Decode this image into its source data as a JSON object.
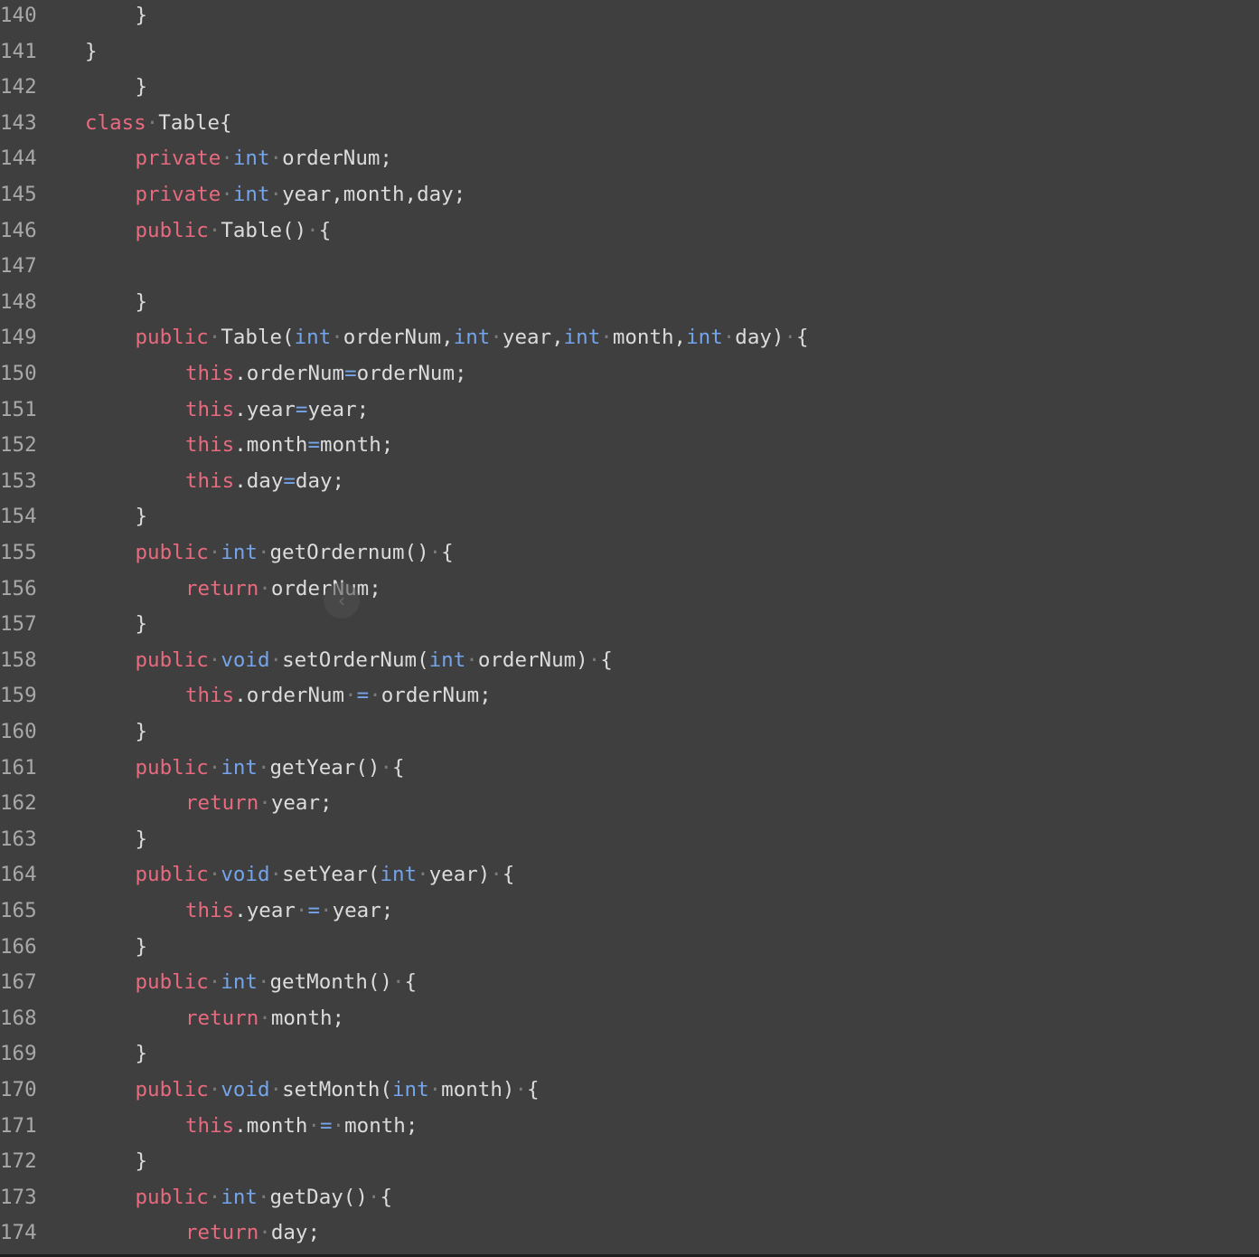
{
  "editor": {
    "lines": [
      {
        "num": "140",
        "indent": 1,
        "tokens": [
          {
            "t": "}",
            "c": "plain"
          }
        ]
      },
      {
        "num": "141",
        "indent": 0,
        "tokens": [
          {
            "t": "}",
            "c": "plain"
          }
        ]
      },
      {
        "num": "142",
        "indent": 1,
        "tokens": [
          {
            "t": "}",
            "c": "plain"
          }
        ]
      },
      {
        "num": "143",
        "indent": 0,
        "tokens": [
          {
            "t": "class",
            "c": "kw"
          },
          {
            "t": "·",
            "c": "ws"
          },
          {
            "t": "Table{",
            "c": "plain"
          }
        ]
      },
      {
        "num": "144",
        "indent": 1,
        "tokens": [
          {
            "t": "private",
            "c": "kw"
          },
          {
            "t": "·",
            "c": "ws"
          },
          {
            "t": "int",
            "c": "ty"
          },
          {
            "t": "·",
            "c": "ws"
          },
          {
            "t": "orderNum;",
            "c": "plain"
          }
        ]
      },
      {
        "num": "145",
        "indent": 1,
        "tokens": [
          {
            "t": "private",
            "c": "kw"
          },
          {
            "t": "·",
            "c": "ws"
          },
          {
            "t": "int",
            "c": "ty"
          },
          {
            "t": "·",
            "c": "ws"
          },
          {
            "t": "year,month,day;",
            "c": "plain"
          }
        ]
      },
      {
        "num": "146",
        "indent": 1,
        "tokens": [
          {
            "t": "public",
            "c": "kw"
          },
          {
            "t": "·",
            "c": "ws"
          },
          {
            "t": "Table()",
            "c": "plain"
          },
          {
            "t": "·",
            "c": "ws"
          },
          {
            "t": "{",
            "c": "plain"
          }
        ]
      },
      {
        "num": "147",
        "indent": 0,
        "tokens": []
      },
      {
        "num": "148",
        "indent": 1,
        "tokens": [
          {
            "t": "}",
            "c": "plain"
          }
        ]
      },
      {
        "num": "149",
        "indent": 1,
        "tokens": [
          {
            "t": "public",
            "c": "kw"
          },
          {
            "t": "·",
            "c": "ws"
          },
          {
            "t": "Table(",
            "c": "plain"
          },
          {
            "t": "int",
            "c": "ty"
          },
          {
            "t": "·",
            "c": "ws"
          },
          {
            "t": "orderNum,",
            "c": "plain"
          },
          {
            "t": "int",
            "c": "ty"
          },
          {
            "t": "·",
            "c": "ws"
          },
          {
            "t": "year,",
            "c": "plain"
          },
          {
            "t": "int",
            "c": "ty"
          },
          {
            "t": "·",
            "c": "ws"
          },
          {
            "t": "month,",
            "c": "plain"
          },
          {
            "t": "int",
            "c": "ty"
          },
          {
            "t": "·",
            "c": "ws"
          },
          {
            "t": "day)",
            "c": "plain"
          },
          {
            "t": "·",
            "c": "ws"
          },
          {
            "t": "{",
            "c": "plain"
          }
        ]
      },
      {
        "num": "150",
        "indent": 2,
        "tokens": [
          {
            "t": "this",
            "c": "kw"
          },
          {
            "t": ".orderNum",
            "c": "plain"
          },
          {
            "t": "=",
            "c": "op"
          },
          {
            "t": "orderNum;",
            "c": "plain"
          }
        ]
      },
      {
        "num": "151",
        "indent": 2,
        "tokens": [
          {
            "t": "this",
            "c": "kw"
          },
          {
            "t": ".year",
            "c": "plain"
          },
          {
            "t": "=",
            "c": "op"
          },
          {
            "t": "year;",
            "c": "plain"
          }
        ]
      },
      {
        "num": "152",
        "indent": 2,
        "tokens": [
          {
            "t": "this",
            "c": "kw"
          },
          {
            "t": ".month",
            "c": "plain"
          },
          {
            "t": "=",
            "c": "op"
          },
          {
            "t": "month;",
            "c": "plain"
          }
        ]
      },
      {
        "num": "153",
        "indent": 2,
        "tokens": [
          {
            "t": "this",
            "c": "kw"
          },
          {
            "t": ".day",
            "c": "plain"
          },
          {
            "t": "=",
            "c": "op"
          },
          {
            "t": "day;",
            "c": "plain"
          }
        ]
      },
      {
        "num": "154",
        "indent": 1,
        "tokens": [
          {
            "t": "}",
            "c": "plain"
          }
        ]
      },
      {
        "num": "155",
        "indent": 1,
        "tokens": [
          {
            "t": "public",
            "c": "kw"
          },
          {
            "t": "·",
            "c": "ws"
          },
          {
            "t": "int",
            "c": "ty"
          },
          {
            "t": "·",
            "c": "ws"
          },
          {
            "t": "getOrdernum()",
            "c": "plain"
          },
          {
            "t": "·",
            "c": "ws"
          },
          {
            "t": "{",
            "c": "plain"
          }
        ]
      },
      {
        "num": "156",
        "indent": 2,
        "tokens": [
          {
            "t": "return",
            "c": "kw"
          },
          {
            "t": "·",
            "c": "ws"
          },
          {
            "t": "orderNum;",
            "c": "plain"
          }
        ]
      },
      {
        "num": "157",
        "indent": 1,
        "tokens": [
          {
            "t": "}",
            "c": "plain"
          }
        ]
      },
      {
        "num": "158",
        "indent": 1,
        "tokens": [
          {
            "t": "public",
            "c": "kw"
          },
          {
            "t": "·",
            "c": "ws"
          },
          {
            "t": "void",
            "c": "ty"
          },
          {
            "t": "·",
            "c": "ws"
          },
          {
            "t": "setOrderNum(",
            "c": "plain"
          },
          {
            "t": "int",
            "c": "ty"
          },
          {
            "t": "·",
            "c": "ws"
          },
          {
            "t": "orderNum)",
            "c": "plain"
          },
          {
            "t": "·",
            "c": "ws"
          },
          {
            "t": "{",
            "c": "plain"
          }
        ]
      },
      {
        "num": "159",
        "indent": 2,
        "tokens": [
          {
            "t": "this",
            "c": "kw"
          },
          {
            "t": ".orderNum",
            "c": "plain"
          },
          {
            "t": "·",
            "c": "ws"
          },
          {
            "t": "=",
            "c": "op"
          },
          {
            "t": "·",
            "c": "ws"
          },
          {
            "t": "orderNum;",
            "c": "plain"
          }
        ]
      },
      {
        "num": "160",
        "indent": 1,
        "tokens": [
          {
            "t": "}",
            "c": "plain"
          }
        ]
      },
      {
        "num": "161",
        "indent": 1,
        "tokens": [
          {
            "t": "public",
            "c": "kw"
          },
          {
            "t": "·",
            "c": "ws"
          },
          {
            "t": "int",
            "c": "ty"
          },
          {
            "t": "·",
            "c": "ws"
          },
          {
            "t": "getYear()",
            "c": "plain"
          },
          {
            "t": "·",
            "c": "ws"
          },
          {
            "t": "{",
            "c": "plain"
          }
        ]
      },
      {
        "num": "162",
        "indent": 2,
        "tokens": [
          {
            "t": "return",
            "c": "kw"
          },
          {
            "t": "·",
            "c": "ws"
          },
          {
            "t": "year;",
            "c": "plain"
          }
        ]
      },
      {
        "num": "163",
        "indent": 1,
        "tokens": [
          {
            "t": "}",
            "c": "plain"
          }
        ]
      },
      {
        "num": "164",
        "indent": 1,
        "tokens": [
          {
            "t": "public",
            "c": "kw"
          },
          {
            "t": "·",
            "c": "ws"
          },
          {
            "t": "void",
            "c": "ty"
          },
          {
            "t": "·",
            "c": "ws"
          },
          {
            "t": "setYear(",
            "c": "plain"
          },
          {
            "t": "int",
            "c": "ty"
          },
          {
            "t": "·",
            "c": "ws"
          },
          {
            "t": "year)",
            "c": "plain"
          },
          {
            "t": "·",
            "c": "ws"
          },
          {
            "t": "{",
            "c": "plain"
          }
        ]
      },
      {
        "num": "165",
        "indent": 2,
        "tokens": [
          {
            "t": "this",
            "c": "kw"
          },
          {
            "t": ".year",
            "c": "plain"
          },
          {
            "t": "·",
            "c": "ws"
          },
          {
            "t": "=",
            "c": "op"
          },
          {
            "t": "·",
            "c": "ws"
          },
          {
            "t": "year;",
            "c": "plain"
          }
        ]
      },
      {
        "num": "166",
        "indent": 1,
        "tokens": [
          {
            "t": "}",
            "c": "plain"
          }
        ]
      },
      {
        "num": "167",
        "indent": 1,
        "tokens": [
          {
            "t": "public",
            "c": "kw"
          },
          {
            "t": "·",
            "c": "ws"
          },
          {
            "t": "int",
            "c": "ty"
          },
          {
            "t": "·",
            "c": "ws"
          },
          {
            "t": "getMonth()",
            "c": "plain"
          },
          {
            "t": "·",
            "c": "ws"
          },
          {
            "t": "{",
            "c": "plain"
          }
        ]
      },
      {
        "num": "168",
        "indent": 2,
        "tokens": [
          {
            "t": "return",
            "c": "kw"
          },
          {
            "t": "·",
            "c": "ws"
          },
          {
            "t": "month;",
            "c": "plain"
          }
        ]
      },
      {
        "num": "169",
        "indent": 1,
        "tokens": [
          {
            "t": "}",
            "c": "plain"
          }
        ]
      },
      {
        "num": "170",
        "indent": 1,
        "tokens": [
          {
            "t": "public",
            "c": "kw"
          },
          {
            "t": "·",
            "c": "ws"
          },
          {
            "t": "void",
            "c": "ty"
          },
          {
            "t": "·",
            "c": "ws"
          },
          {
            "t": "setMonth(",
            "c": "plain"
          },
          {
            "t": "int",
            "c": "ty"
          },
          {
            "t": "·",
            "c": "ws"
          },
          {
            "t": "month)",
            "c": "plain"
          },
          {
            "t": "·",
            "c": "ws"
          },
          {
            "t": "{",
            "c": "plain"
          }
        ]
      },
      {
        "num": "171",
        "indent": 2,
        "tokens": [
          {
            "t": "this",
            "c": "kw"
          },
          {
            "t": ".month",
            "c": "plain"
          },
          {
            "t": "·",
            "c": "ws"
          },
          {
            "t": "=",
            "c": "op"
          },
          {
            "t": "·",
            "c": "ws"
          },
          {
            "t": "month;",
            "c": "plain"
          }
        ]
      },
      {
        "num": "172",
        "indent": 1,
        "tokens": [
          {
            "t": "}",
            "c": "plain"
          }
        ]
      },
      {
        "num": "173",
        "indent": 1,
        "tokens": [
          {
            "t": "public",
            "c": "kw"
          },
          {
            "t": "·",
            "c": "ws"
          },
          {
            "t": "int",
            "c": "ty"
          },
          {
            "t": "·",
            "c": "ws"
          },
          {
            "t": "getDay()",
            "c": "plain"
          },
          {
            "t": "·",
            "c": "ws"
          },
          {
            "t": "{",
            "c": "plain"
          }
        ]
      },
      {
        "num": "174",
        "indent": 2,
        "tokens": [
          {
            "t": "return",
            "c": "kw"
          },
          {
            "t": "·",
            "c": "ws"
          },
          {
            "t": "day;",
            "c": "plain"
          }
        ]
      }
    ]
  },
  "colors": {
    "background": "#3f3f3f",
    "keyword": "#e86a7e",
    "type": "#74a4ea",
    "text": "#dcdcdc",
    "line_number": "#a8a8a8",
    "whitespace_dot": "#7a7a7a"
  },
  "collapse_handle": {
    "icon": "chevron-left-icon",
    "glyph": "‹"
  }
}
